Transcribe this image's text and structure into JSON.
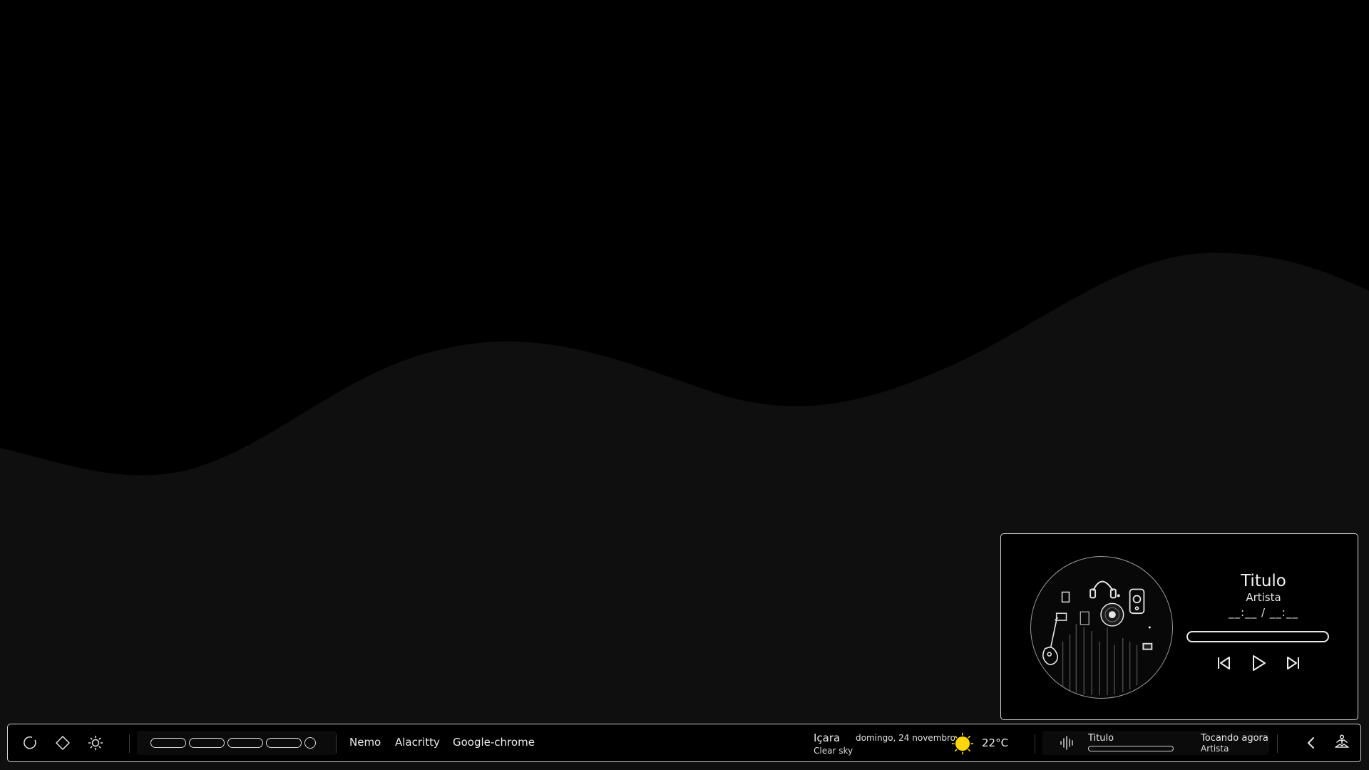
{
  "colors": {
    "background": "#000000",
    "wave": "#0f0f0f",
    "border": "#d6d6d6",
    "text": "#ececec",
    "sun": "#ffd60a"
  },
  "music_popup": {
    "title": "Titulo",
    "artist": "Artista",
    "time": "__:__ / __:__",
    "progress": 0,
    "controls": {
      "previous_icon": "skip-previous-icon",
      "play_icon": "play-icon",
      "next_icon": "skip-next-icon"
    },
    "album_art_icon": "music-instruments-art"
  },
  "bar": {
    "left_icons": [
      "circle-icon",
      "diamond-icon",
      "brightness-icon"
    ],
    "workspaces": [
      {
        "kind": "pill"
      },
      {
        "kind": "pill"
      },
      {
        "kind": "pill"
      },
      {
        "kind": "pill"
      },
      {
        "kind": "dot"
      }
    ],
    "tasks": [
      "Nemo",
      "Alacritty",
      "Google-chrome"
    ],
    "weather": {
      "city": "Içara",
      "description": "Clear sky",
      "temperature": "22°C",
      "icon": "sun-icon"
    },
    "date": "domingo, 24 novembro",
    "mini_player": {
      "icon": "audio-wave-icon",
      "title": "Titulo",
      "status": "Tocando agora",
      "artist": "Artista",
      "progress": 0
    },
    "right_icons": [
      "chevron-left-icon",
      "meditation-icon"
    ]
  }
}
